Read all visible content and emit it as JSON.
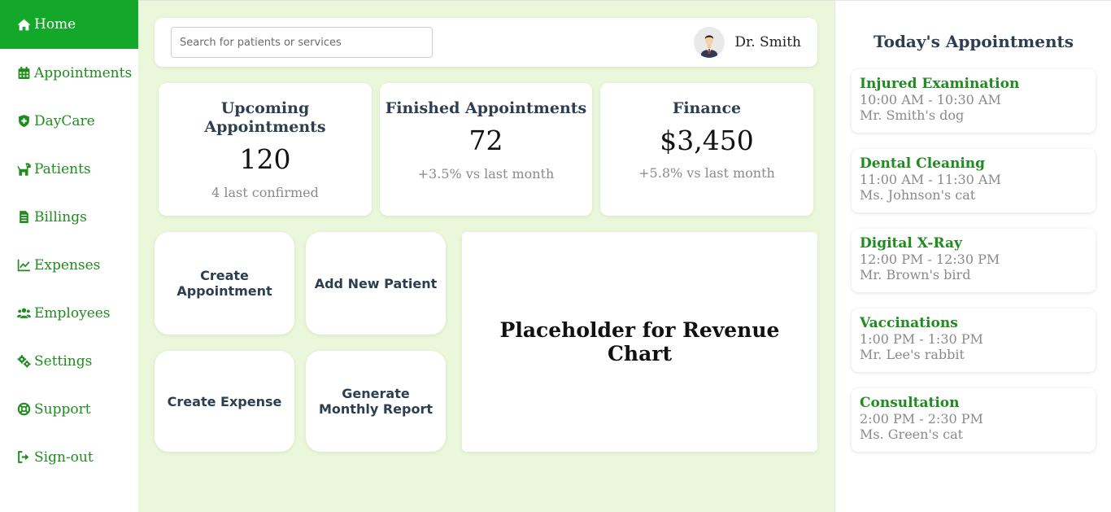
{
  "sidebar": {
    "items": [
      {
        "label": "Home",
        "icon": "home-icon"
      },
      {
        "label": "Appointments",
        "icon": "calendar-icon"
      },
      {
        "label": "DayCare",
        "icon": "shield-icon"
      },
      {
        "label": "Patients",
        "icon": "dog-icon"
      },
      {
        "label": "Billings",
        "icon": "file-invoice-icon"
      },
      {
        "label": "Expenses",
        "icon": "chart-line-icon"
      },
      {
        "label": "Employees",
        "icon": "users-icon"
      },
      {
        "label": "Settings",
        "icon": "gears-icon"
      },
      {
        "label": "Support",
        "icon": "life-ring-icon"
      },
      {
        "label": "Sign-out",
        "icon": "sign-out-icon"
      }
    ]
  },
  "header": {
    "search_placeholder": "Search for patients or services",
    "user_name": "Dr. Smith"
  },
  "stats": [
    {
      "title": "Upcoming Appointments",
      "value": "120",
      "sub": "4 last confirmed"
    },
    {
      "title": "Finished Appointments",
      "value": "72",
      "sub": "+3.5% vs last month"
    },
    {
      "title": "Finance",
      "value": "$3,450",
      "sub": "+5.8% vs last month"
    }
  ],
  "actions": {
    "create_appointment": "Create Appointment",
    "add_patient": "Add New Patient",
    "create_expense": "Create Expense",
    "monthly_report": "Generate Monthly Report"
  },
  "chart_placeholder": "Placeholder for Revenue Chart",
  "appointments": {
    "title": "Today's Appointments",
    "items": [
      {
        "title": "Injured Examination",
        "time": "10:00 AM - 10:30 AM",
        "pet": "Mr. Smith's dog"
      },
      {
        "title": "Dental Cleaning",
        "time": "11:00 AM - 11:30 AM",
        "pet": "Ms. Johnson's cat"
      },
      {
        "title": "Digital X-Ray",
        "time": "12:00 PM - 12:30 PM",
        "pet": "Mr. Brown's bird"
      },
      {
        "title": "Vaccinations",
        "time": "1:00 PM - 1:30 PM",
        "pet": "Mr. Lee's rabbit"
      },
      {
        "title": "Consultation",
        "time": "2:00 PM - 2:30 PM",
        "pet": "Ms. Green's cat"
      }
    ]
  },
  "colors": {
    "accent": "#14a82b",
    "nav_text": "#1e8c1e",
    "main_bg": "#eaf7da",
    "heading": "#2c3e50"
  }
}
